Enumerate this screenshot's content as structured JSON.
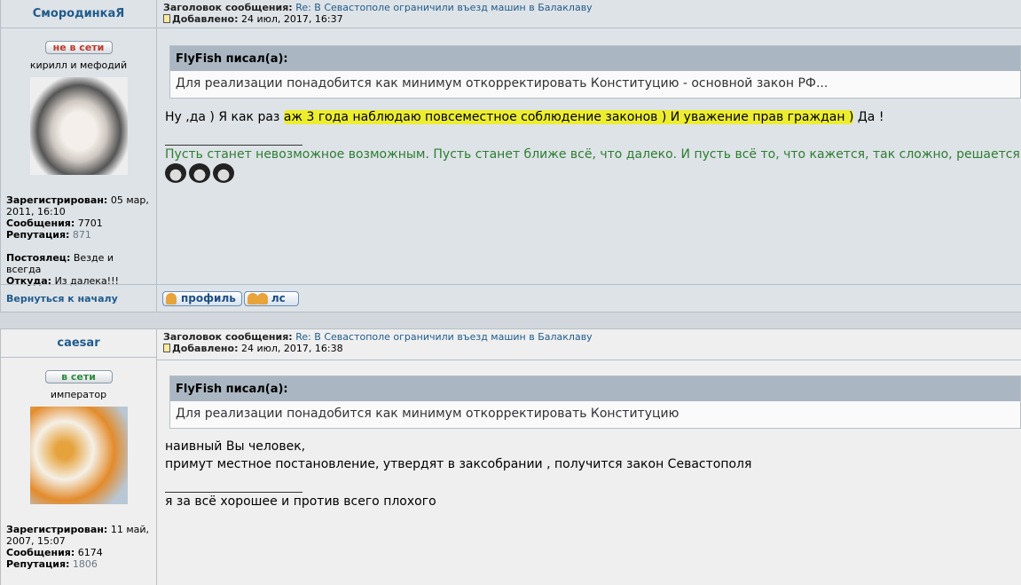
{
  "posts": [
    {
      "author": "СмородинкаЯ",
      "subject_label": "Заголовок сообщения:",
      "subject": "Re: В Севастополе ограничили въезд машин в Балаклаву",
      "added_label": "Добавлено:",
      "added": "24 июл, 2017, 16:37",
      "status": "не в сети",
      "status_color": "#c0392b",
      "rank": "кирилл и мефодий",
      "registered_label": "Зарегистрирован:",
      "registered": "05 мар, 2011, 16:10",
      "posts_label": "Сообщения:",
      "posts": "7701",
      "rep_label": "Репутация:",
      "rep": "871",
      "extra1_label": "Постоялец:",
      "extra1": "Везде и всегда",
      "extra2_label": "Откуда:",
      "extra2": "Из далека!!!",
      "quote_author": "FlyFish писал(а):",
      "quote_text": "Для реализации понадобится как минимум откорректировать Конституцию - основной закон РФ...",
      "text_pre": "Ну ,да ) Я как раз ",
      "text_hl": "аж 3 года наблюдаю повсеместное соблюдение законов ) И уважение прав граждан )",
      "text_post": " Да !",
      "signature": "Пусть станет невозможное возможным. Пусть станет ближе всё, что далеко. И пусть всё то, что кажется, так сложно, решается",
      "back_to_top": "Вернуться к началу",
      "profile_btn": "профиль",
      "pm_btn": "лс"
    },
    {
      "author": "caesar",
      "subject_label": "Заголовок сообщения:",
      "subject": "Re: В Севастополе ограничили въезд машин в Балаклаву",
      "added_label": "Добавлено:",
      "added": "24 июл, 2017, 16:38",
      "status": "в сети",
      "status_color": "#2e8b3d",
      "rank": "император",
      "registered_label": "Зарегистрирован:",
      "registered": "11 май, 2007, 15:07",
      "posts_label": "Сообщения:",
      "posts": "6174",
      "rep_label": "Репутация:",
      "rep": "1806",
      "quote_author": "FlyFish писал(а):",
      "quote_text": "Для реализации понадобится как минимум откорректировать Конституцию",
      "line1": "наивный Вы человек,",
      "line2": "примут местное постановление, утвердят в заксобрании , получится закон Севастополя",
      "signature": "я за всё хорошее и против всего плохого"
    }
  ]
}
